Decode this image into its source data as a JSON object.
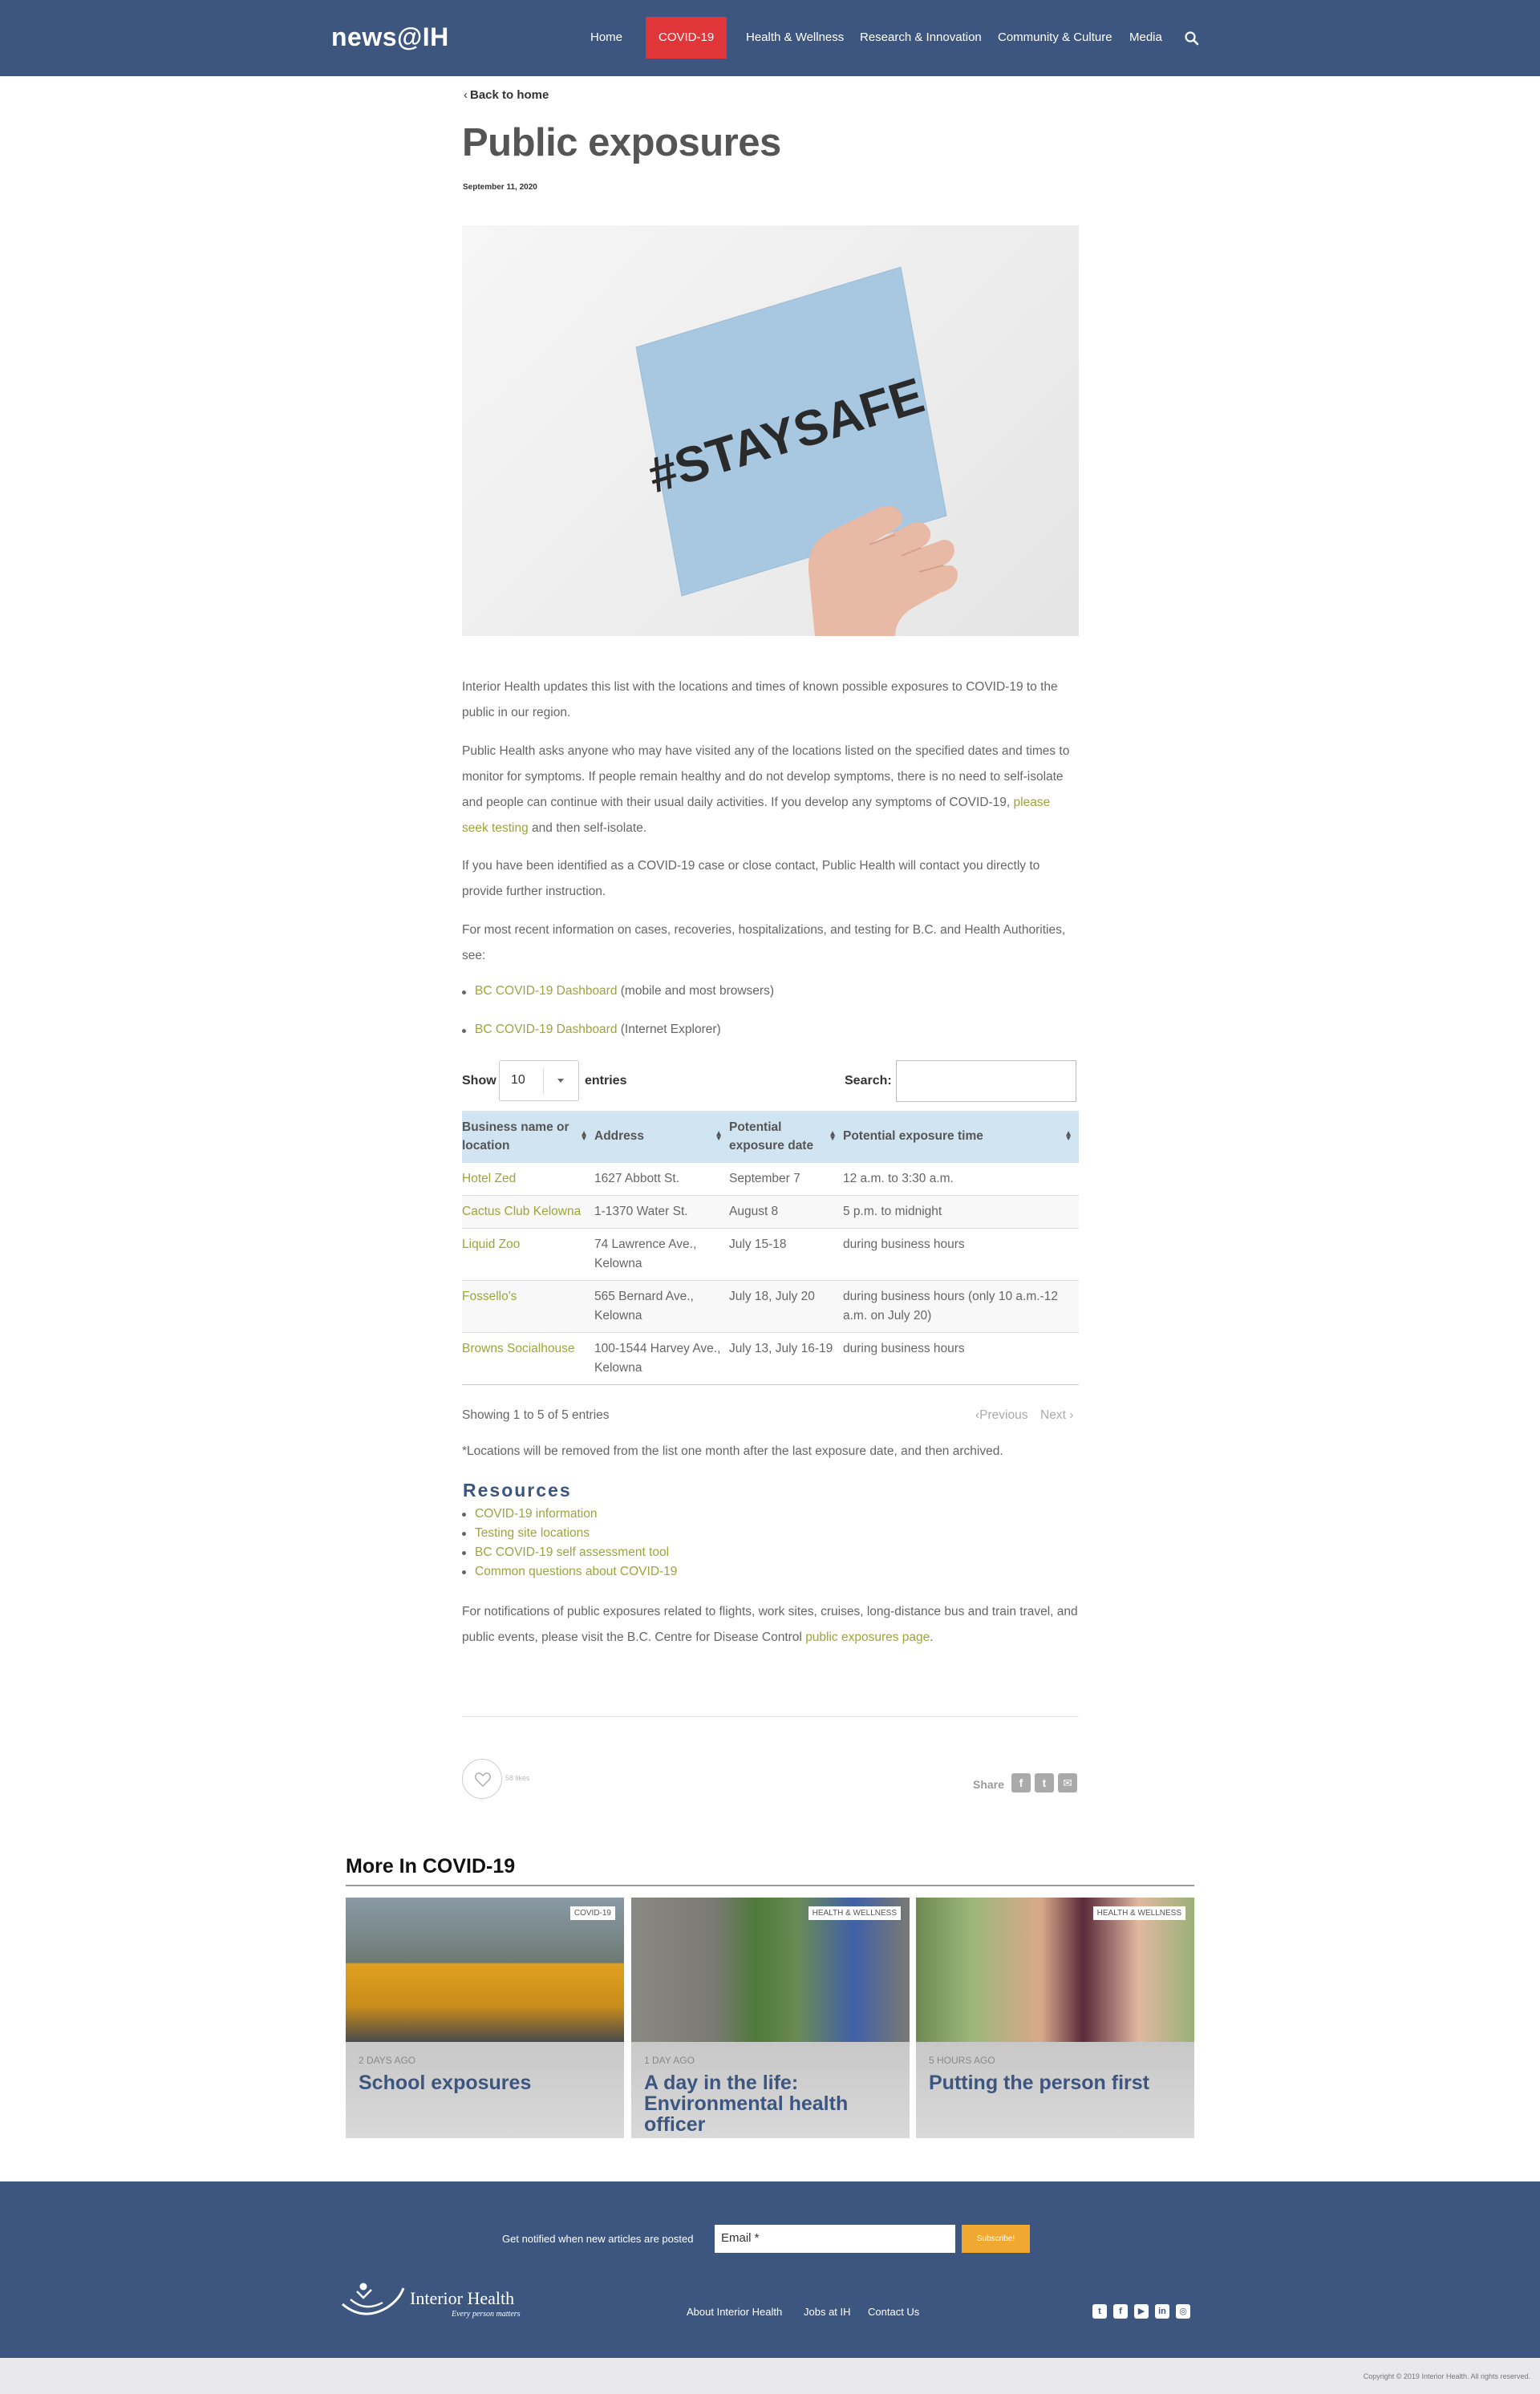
{
  "nav": {
    "logo": "news@IH",
    "items": [
      "Home",
      "COVID-19",
      "Health & Wellness",
      "Research & Innovation",
      "Community & Culture",
      "Media"
    ],
    "active_color": "#e0363a",
    "bar_color": "#3d5680"
  },
  "article": {
    "back_label": "Back to home",
    "title": "Public exposures",
    "date": "September 11, 2020",
    "hero_sign_text": "#STAYSAFE",
    "p1": "Interior Health updates this list with the locations and times of known possible exposures to COVID-19 to the public in our region.",
    "p2_before": "Public Health asks anyone who may have visited any of the locations listed on the specified dates and times to monitor for symptoms. If people remain healthy and do not develop symptoms, there is no need to self-isolate and people can continue with their usual daily activities. If you develop any symptoms of COVID-19, ",
    "p2_link": "please seek testing",
    "p2_after": " and then self-isolate.",
    "p3": "If you have been identified as a COVID-19 case or close contact, Public Health will contact you directly to provide further instruction.",
    "p4": "For most recent information on cases, recoveries, hospitalizations, and testing for B.C. and Health Authorities, see:",
    "dash1_link": "BC COVID-19 Dashboard",
    "dash1_note": " (mobile and most browsers)",
    "dash2_link": "BC COVID-19 Dashboard",
    "dash2_note": " (Internet Explorer)"
  },
  "table": {
    "show_label": "Show",
    "entries_value": "10",
    "entries_label": "entries",
    "search_label": "Search:",
    "columns": [
      "Business name or location",
      "Address",
      "Potential exposure date",
      "Potential exposure time"
    ],
    "rows": [
      {
        "name": "Hotel Zed",
        "address": "1627 Abbott St.",
        "date": "September 7",
        "time": "12 a.m. to 3:30 a.m."
      },
      {
        "name": "Cactus Club Kelowna",
        "address": "1-1370 Water St.",
        "date": "August 8",
        "time": "5 p.m. to midnight"
      },
      {
        "name": "Liquid Zoo",
        "address": "74 Lawrence Ave., Kelowna",
        "date": "July 15-18",
        "time": "during business hours"
      },
      {
        "name": "Fossello's",
        "address": "565 Bernard Ave., Kelowna",
        "date": "July 18, July 20",
        "time": "during business hours (only 10 a.m.-12 a.m. on July 20)"
      },
      {
        "name": "Browns Socialhouse",
        "address": "100-1544 Harvey Ave., Kelowna",
        "date": "July 13, July 16-19",
        "time": "during business hours"
      }
    ],
    "info": "Showing 1 to 5 of 5 entries",
    "prev": "Previous",
    "next": "Next",
    "header_bg": "#d0e4f1"
  },
  "footnote": "*Locations will be removed from the list one month after the last exposure date, and then archived.",
  "resources": {
    "title": "Resources",
    "links": [
      "COVID-19 information",
      "Testing site locations",
      "BC COVID-19 self assessment tool",
      "Common questions about COVID-19"
    ]
  },
  "closing": {
    "before": "For notifications of public exposures related to flights, work sites, cruises, long-distance bus and train travel, and public events, please visit the B.C. Centre for Disease Control ",
    "link": "public exposures page",
    "after": "."
  },
  "social": {
    "likes": "58 likes",
    "share": "Share",
    "icons": [
      "facebook-icon",
      "twitter-icon",
      "email-icon"
    ]
  },
  "more": {
    "title": "More In COVID-19",
    "cards": [
      {
        "tag": "COVID-19",
        "ago": "2 days ago",
        "title": "School exposures"
      },
      {
        "tag": "HEALTH & WELLNESS",
        "ago": "1 day ago",
        "title": "A day in the life: Environmental health officer"
      },
      {
        "tag": "HEALTH & WELLNESS",
        "ago": "5 hours ago",
        "title": "Putting the person first"
      }
    ]
  },
  "footer": {
    "notify": "Get notified when new articles are posted",
    "email_placeholder": "Email *",
    "subscribe": "Subscribe!",
    "brand": "Interior Health",
    "tagline": "Every person matters",
    "links": [
      "About Interior Health",
      "Jobs at IH",
      "Contact Us"
    ],
    "copyright": "Copyright © 2019 Interior Health. All rights reserved."
  }
}
